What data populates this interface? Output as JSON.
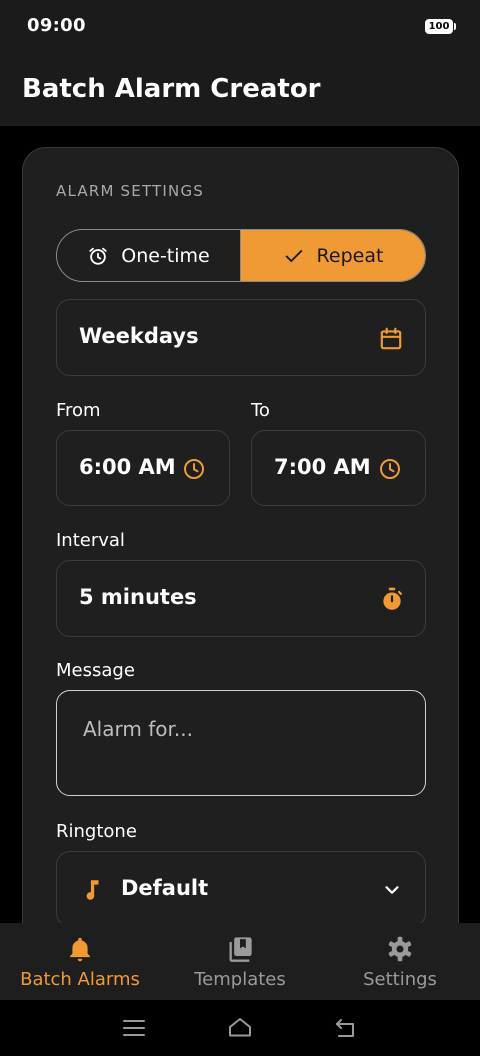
{
  "status_bar": {
    "time": "09:00",
    "battery": "100"
  },
  "app_bar": {
    "title": "Batch Alarm Creator"
  },
  "card": {
    "section_label": "ALARM SETTINGS",
    "mode": {
      "one_time_label": "One-time",
      "repeat_label": "Repeat",
      "selected": "Repeat"
    },
    "days": {
      "value": "Weekdays",
      "icon": "calendar-icon"
    },
    "from": {
      "label": "From",
      "value": "6:00 AM",
      "icon": "clock-icon"
    },
    "to": {
      "label": "To",
      "value": "7:00 AM",
      "icon": "clock-icon"
    },
    "interval": {
      "label": "Interval",
      "value": "5 minutes",
      "icon": "stopwatch-icon"
    },
    "message": {
      "label": "Message",
      "placeholder": "Alarm for..."
    },
    "ringtone": {
      "label": "Ringtone",
      "value": "Default",
      "icon": "music-note-icon"
    }
  },
  "bottom_nav": {
    "items": [
      {
        "label": "Batch Alarms",
        "icon": "bell-icon",
        "active": true
      },
      {
        "label": "Templates",
        "icon": "templates-icon",
        "active": false
      },
      {
        "label": "Settings",
        "icon": "gear-icon",
        "active": false
      }
    ]
  },
  "colors": {
    "accent": "#f09a35",
    "background": "#000000",
    "surface": "#1f1f1f",
    "inactive": "#9a9a9a"
  }
}
